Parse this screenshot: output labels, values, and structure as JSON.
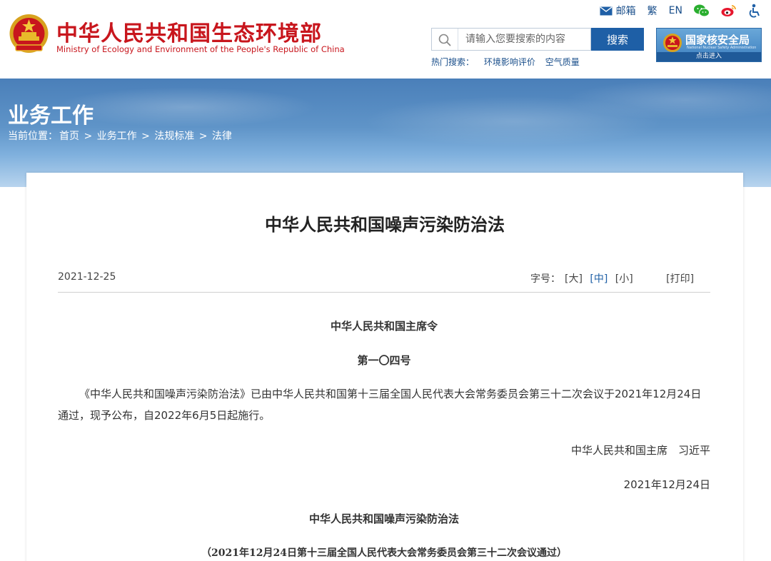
{
  "header": {
    "site_title": "中华人民共和国生态环境部",
    "site_subtitle": "Ministry of Ecology and Environment of the People's Republic of China",
    "toplinks": {
      "mail": "邮箱",
      "traditional": "繁",
      "english": "EN"
    },
    "search": {
      "placeholder": "请输入您要搜索的内容",
      "button": "搜索",
      "hot_label": "热门搜索：",
      "hot_items": [
        "环境影响评价",
        "空气质量"
      ]
    },
    "nnsa": {
      "name": "国家核安全局",
      "en": "National Nuclear Safety Administration",
      "enter": "点击进入"
    }
  },
  "banner": {
    "title": "业务工作",
    "crumb_label": "当前位置：",
    "crumbs": [
      "首页",
      "业务工作",
      "法规标准",
      "法律"
    ],
    "sep": ">"
  },
  "article": {
    "title": "中华人民共和国噪声污染防治法",
    "date": "2021-12-25",
    "font_label": "字号：",
    "font_large": "[大]",
    "font_medium": "[中]",
    "font_small": "[小]",
    "print": "[打印]",
    "order_title": "中华人民共和国主席令",
    "order_no": "第一〇四号",
    "paragraph": "《中华人民共和国噪声污染防治法》已由中华人民共和国第十三届全国人民代表大会常务委员会第三十二次会议于2021年12月24日通过，现予公布，自2022年6月5日起施行。",
    "signatory": "中华人民共和国主席　习近平",
    "sign_date": "2021年12月24日",
    "law_title": "中华人民共和国噪声污染防治法",
    "law_note": "（2021年12月24日第十三届全国人民代表大会常务委员会第三十二次会议通过）"
  },
  "colors": {
    "brand_red": "#c8161d",
    "link_blue": "#1a4f8b",
    "button_blue": "#1e5fa6"
  }
}
